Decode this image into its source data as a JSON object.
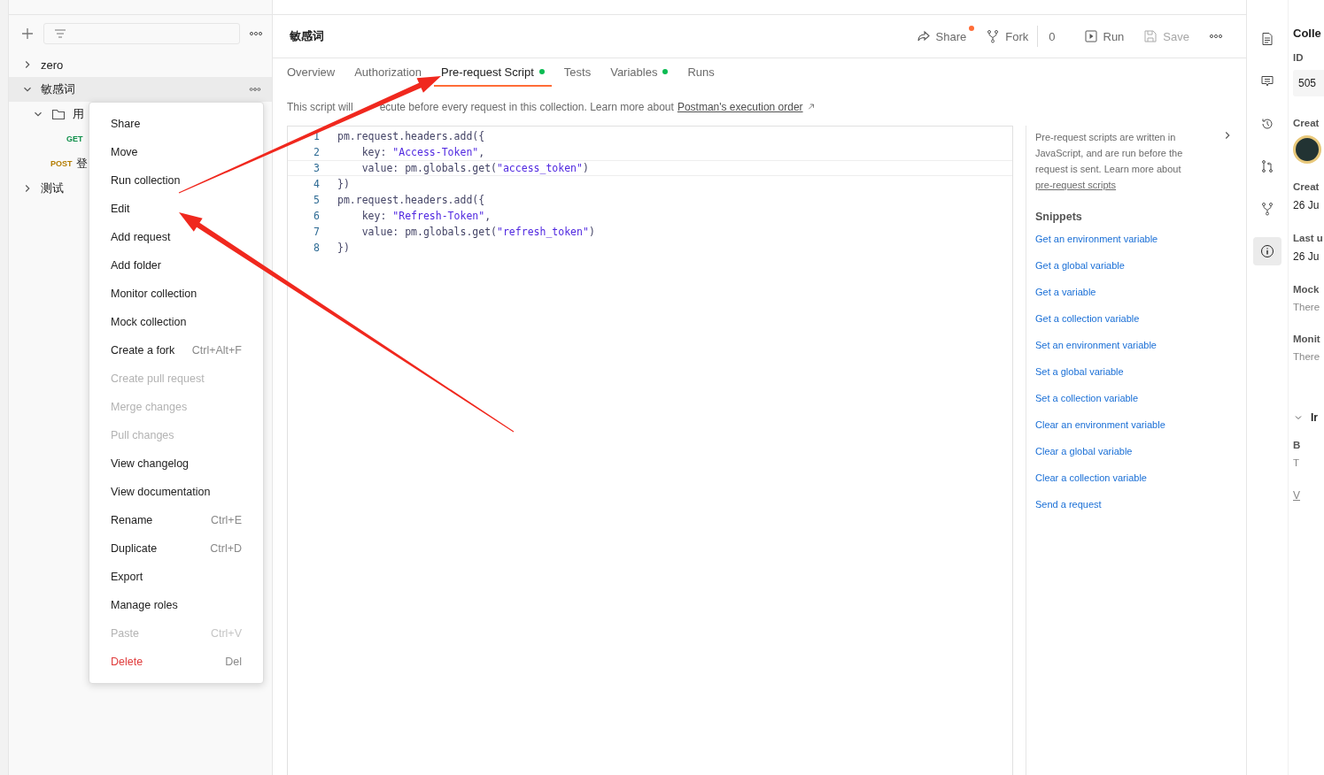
{
  "sidebar": {
    "tree": [
      {
        "label": "zero",
        "expanded": false,
        "selected": false,
        "kind": "collection"
      },
      {
        "label": "敏感词",
        "expanded": true,
        "selected": true,
        "kind": "collection",
        "children": [
          {
            "label": "用",
            "expanded": true,
            "selected": false,
            "kind": "folder",
            "children": [
              {
                "method": "GET",
                "selected": false,
                "kind": "request"
              }
            ]
          },
          {
            "label": "登",
            "method": "POST",
            "selected": false,
            "kind": "request"
          }
        ]
      },
      {
        "label": "测试",
        "expanded": false,
        "selected": false,
        "kind": "collection"
      }
    ]
  },
  "context_menu": [
    {
      "label": "Share",
      "kind": "normal"
    },
    {
      "label": "Move",
      "kind": "normal"
    },
    {
      "label": "Run collection",
      "kind": "normal"
    },
    {
      "label": "Edit",
      "kind": "normal"
    },
    {
      "label": "Add request",
      "kind": "normal"
    },
    {
      "label": "Add folder",
      "kind": "normal"
    },
    {
      "label": "Monitor collection",
      "kind": "normal"
    },
    {
      "label": "Mock collection",
      "kind": "normal"
    },
    {
      "label": "Create a fork",
      "shortcut": "Ctrl+Alt+F",
      "kind": "normal"
    },
    {
      "label": "Create pull request",
      "kind": "disabled"
    },
    {
      "label": "Merge changes",
      "kind": "disabled"
    },
    {
      "label": "Pull changes",
      "kind": "disabled"
    },
    {
      "label": "View changelog",
      "kind": "normal"
    },
    {
      "label": "View documentation",
      "kind": "normal"
    },
    {
      "label": "Rename",
      "shortcut": "Ctrl+E",
      "kind": "normal"
    },
    {
      "label": "Duplicate",
      "shortcut": "Ctrl+D",
      "kind": "normal"
    },
    {
      "label": "Export",
      "kind": "normal"
    },
    {
      "label": "Manage roles",
      "kind": "normal"
    },
    {
      "label": "Paste",
      "shortcut": "Ctrl+V",
      "kind": "disabled"
    },
    {
      "label": "Delete",
      "shortcut": "Del",
      "kind": "danger"
    }
  ],
  "collection": {
    "title": "敏感词",
    "actions": [
      {
        "label": "Share",
        "kind": "button",
        "notify": true,
        "disabled": false
      },
      {
        "label": "Fork",
        "kind": "button",
        "disabled": false
      },
      {
        "label": "0",
        "kind": "count"
      },
      {
        "label": "Run",
        "kind": "button",
        "disabled": false
      },
      {
        "label": "Save",
        "kind": "button",
        "disabled": true
      },
      {
        "kind": "menu"
      }
    ],
    "tabs": [
      {
        "label": "Overview",
        "selected": false,
        "dot": false
      },
      {
        "label": "Authorization",
        "selected": false,
        "dot": false
      },
      {
        "label": "Pre-request Script",
        "selected": true,
        "dot": true
      },
      {
        "label": "Tests",
        "selected": false,
        "dot": false
      },
      {
        "label": "Variables",
        "selected": false,
        "dot": true
      },
      {
        "label": "Runs",
        "selected": false,
        "dot": false
      }
    ],
    "description": {
      "before": "This script will",
      "after": "ecute before every request in this collection. Learn more about",
      "link": "Postman's execution order"
    },
    "code": [
      {
        "number": "1",
        "tokens": [
          {
            "kind": "plain",
            "text": "pm.request.headers.add({"
          }
        ]
      },
      {
        "number": "2",
        "tokens": [
          {
            "kind": "plain",
            "text": "    key: "
          },
          {
            "kind": "string",
            "text": "\"Access-Token\""
          },
          {
            "kind": "plain",
            "text": ","
          }
        ]
      },
      {
        "number": "3",
        "tokens": [
          {
            "kind": "plain",
            "text": "    value: pm.globals.get("
          },
          {
            "kind": "string",
            "text": "\"access_token\""
          },
          {
            "kind": "plain",
            "text": ")"
          }
        ],
        "active": true
      },
      {
        "number": "4",
        "tokens": [
          {
            "kind": "plain",
            "text": "})"
          }
        ]
      },
      {
        "number": "5",
        "tokens": [
          {
            "kind": "plain",
            "text": "pm.request.headers.add({"
          }
        ]
      },
      {
        "number": "6",
        "tokens": [
          {
            "kind": "plain",
            "text": "    key: "
          },
          {
            "kind": "string",
            "text": "\"Refresh-Token\""
          },
          {
            "kind": "plain",
            "text": ","
          }
        ]
      },
      {
        "number": "7",
        "tokens": [
          {
            "kind": "plain",
            "text": "    value: pm.globals.get("
          },
          {
            "kind": "string",
            "text": "\"refresh_token\""
          },
          {
            "kind": "plain",
            "text": ")"
          }
        ]
      },
      {
        "number": "8",
        "tokens": [
          {
            "kind": "plain",
            "text": "})"
          }
        ]
      }
    ],
    "help": {
      "text": "Pre-request scripts are written in JavaScript, and are run before the request is sent. Learn more about",
      "link": "pre-request scripts"
    },
    "snippets_title": "Snippets",
    "snippets": [
      "Get an environment variable",
      "Get a global variable",
      "Get a variable",
      "Get a collection variable",
      "Set an environment variable",
      "Set a global variable",
      "Set a collection variable",
      "Clear an environment variable",
      "Clear a global variable",
      "Clear a collection variable",
      "Send a request"
    ]
  },
  "right_rail": [
    {
      "selected": false
    },
    {
      "selected": false
    },
    {
      "selected": false
    },
    {
      "selected": false
    },
    {
      "selected": false
    },
    {
      "selected": true
    }
  ],
  "info_panel": {
    "title": "Colle",
    "items": [
      {
        "kind": "label",
        "text": "ID"
      },
      {
        "kind": "value-box",
        "text": "505"
      },
      {
        "kind": "label",
        "text": "Creat"
      },
      {
        "kind": "avatar"
      },
      {
        "kind": "label",
        "text": "Creat"
      },
      {
        "kind": "value",
        "text": "26 Ju"
      },
      {
        "kind": "label",
        "text": "Last u"
      },
      {
        "kind": "value",
        "text": "26 Ju"
      },
      {
        "kind": "label",
        "text": "Mock"
      },
      {
        "kind": "muted",
        "text": "There"
      },
      {
        "kind": "label",
        "text": "Monit"
      },
      {
        "kind": "muted",
        "text": "There"
      },
      {
        "kind": "section",
        "text": "Ir"
      },
      {
        "kind": "label",
        "text": "B"
      },
      {
        "kind": "muted",
        "text": "T"
      },
      {
        "kind": "link",
        "text": "V"
      }
    ]
  },
  "annotations": [
    {
      "kind": "arrow"
    },
    {
      "kind": "arrow"
    }
  ]
}
